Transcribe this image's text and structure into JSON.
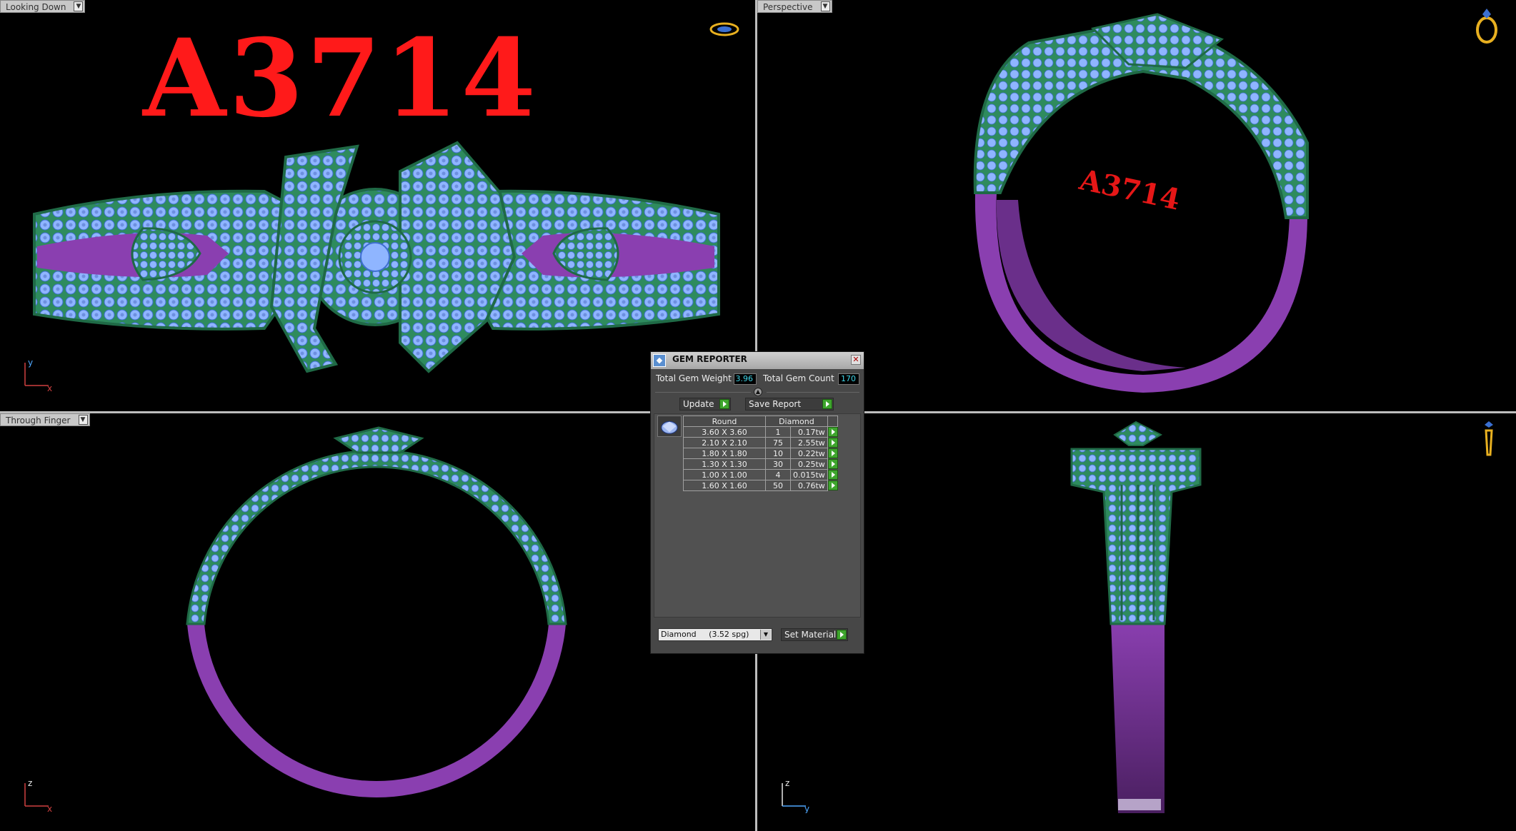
{
  "viewports": {
    "top_left": {
      "label": "Looking Down",
      "axis_v": "y",
      "axis_h": "x",
      "watermark": "A3714"
    },
    "top_right": {
      "label": "Perspective"
    },
    "bottom_left": {
      "label": "Through Finger",
      "axis_v": "z",
      "axis_h": "x"
    },
    "bottom_right": {
      "axis_v": "z",
      "axis_h": "y"
    }
  },
  "colors": {
    "metal_top": "#2e8b5e",
    "metal_bottom": "#8a3fb0",
    "gems": "#8fb5ff",
    "watermark": "#ff1a1a",
    "background": "#000000"
  },
  "icons": [
    "ring-top-icon",
    "ring-perspective-icon",
    "ring-side-icon"
  ],
  "gem_reporter": {
    "title": "GEM REPORTER",
    "total_weight_label": "Total Gem Weight",
    "total_weight_value": "3.96",
    "total_count_label": "Total Gem Count",
    "total_count_value": "170",
    "update_label": "Update",
    "save_report_label": "Save Report",
    "header_shape": "Round",
    "header_material": "Diamond",
    "rows": [
      {
        "size": "3.60 X 3.60",
        "count": "1",
        "weight": "0.17tw"
      },
      {
        "size": "2.10 X 2.10",
        "count": "75",
        "weight": "2.55tw"
      },
      {
        "size": "1.80 X 1.80",
        "count": "10",
        "weight": "0.22tw"
      },
      {
        "size": "1.30 X 1.30",
        "count": "30",
        "weight": "0.25tw"
      },
      {
        "size": "1.00 X 1.00",
        "count": "4",
        "weight": "0.015tw"
      },
      {
        "size": "1.60 X 1.60",
        "count": "50",
        "weight": "0.76tw"
      }
    ],
    "material_select": "Diamond     (3.52 spg)",
    "set_material_label": "Set Material"
  }
}
